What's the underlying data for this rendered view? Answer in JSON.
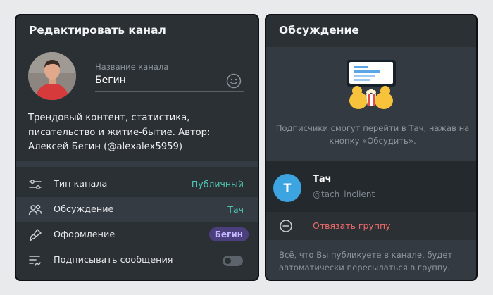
{
  "edit_panel": {
    "title": "Редактировать канал",
    "name_label": "Название канала",
    "name_value": "Бегин",
    "description": "Трендовый контент, статистика, писательство и житие-бытие. Автор: Алексей Бегин (@alexalex5959)",
    "rows": [
      {
        "icon": "sliders-icon",
        "label": "Тип канала",
        "value": "Публичный"
      },
      {
        "icon": "people-icon",
        "label": "Обсуждение",
        "value": "Тач"
      },
      {
        "icon": "brush-icon",
        "label": "Оформление",
        "value": "Бегин"
      },
      {
        "icon": "signature-icon",
        "label": "Подписывать сообщения",
        "value": ""
      }
    ],
    "sign_messages_enabled": false,
    "accent_color": "#4fc6b4",
    "badge_color": "#4c3f7e"
  },
  "discussion_panel": {
    "title": "Обсуждение",
    "info": "Подписчики смогут перейти в Тач, нажав на кнопку «Обсудить».",
    "group": {
      "avatar_letter": "Т",
      "name": "Тач",
      "handle": "@tach_inclient",
      "avatar_color": "#3ca4e0"
    },
    "unlink_label": "Отвязать группу",
    "note": "Всё, что Вы публикуете в канале, будет автоматически пересылаться в группу."
  }
}
